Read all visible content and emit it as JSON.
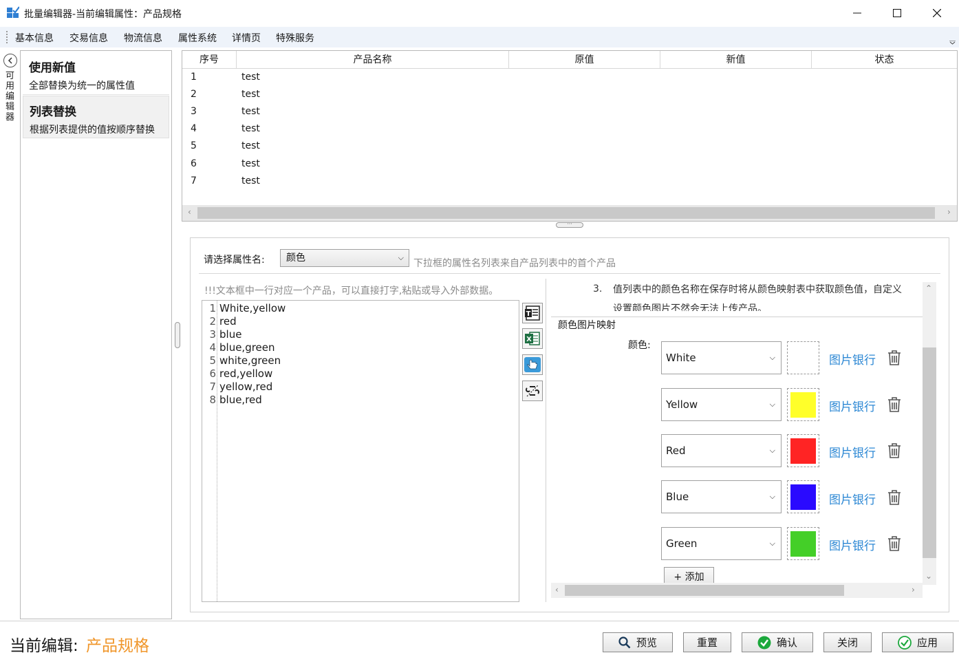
{
  "window": {
    "title": "批量编辑器-当前编辑属性：产品规格",
    "minimize_glyph": "—",
    "maximize_glyph": "☐",
    "close_glyph": "✕"
  },
  "menu": [
    "基本信息",
    "交易信息",
    "物流信息",
    "属性系统",
    "详情页",
    "特殊服务"
  ],
  "side_tab": {
    "label": "可用编辑器"
  },
  "editors": [
    {
      "title": "使用新值",
      "desc": "全部替换为统一的属性值"
    },
    {
      "title": "列表替换",
      "desc": "根据列表提供的值按顺序替换"
    }
  ],
  "grid": {
    "columns": [
      "序号",
      "产品名称",
      "原值",
      "新值",
      "状态"
    ],
    "rows": [
      {
        "no": "1",
        "name": "test"
      },
      {
        "no": "2",
        "name": "test"
      },
      {
        "no": "3",
        "name": "test"
      },
      {
        "no": "4",
        "name": "test"
      },
      {
        "no": "5",
        "name": "test"
      },
      {
        "no": "6",
        "name": "test"
      },
      {
        "no": "7",
        "name": "test"
      }
    ]
  },
  "attr": {
    "label": "请选择属性名:",
    "selected": "颜色",
    "hint": "下拉框的属性名列表来自产品列表中的首个产品"
  },
  "editor": {
    "warning": "!!!文本框中一行对应一个产品，可以直接打字,粘贴或导入外部数据。",
    "lines": [
      "White,yellow",
      "red",
      "blue",
      "blue,green",
      "white,green",
      "red,yellow",
      "yellow,red",
      "blue,red"
    ]
  },
  "notes": {
    "number": "3.",
    "line1": "值列表中的颜色名称在保存时将从颜色映射表中获取颜色值，自定义",
    "line2": "设置颜色图片不然会无法上传产品。"
  },
  "color_map": {
    "title": "颜色图片映射",
    "color_label": "颜色:",
    "bank_label": "图片银行",
    "add_label": "+ 添加",
    "items": [
      {
        "name": "White",
        "color": "#ffffff"
      },
      {
        "name": "Yellow",
        "color": "#ffff2a"
      },
      {
        "name": "Red",
        "color": "#ff2424"
      },
      {
        "name": "Blue",
        "color": "#2a0aff"
      },
      {
        "name": "Green",
        "color": "#44cf28"
      }
    ]
  },
  "status": {
    "label": "当前编辑:",
    "value": "产品规格"
  },
  "buttons": {
    "preview": "预览",
    "reset": "重置",
    "confirm": "确认",
    "close": "关闭",
    "apply": "应用"
  },
  "colors": {
    "accent_orange": "#f0962a",
    "link_blue": "#2d88d4",
    "check_green": "#1ca83c"
  }
}
